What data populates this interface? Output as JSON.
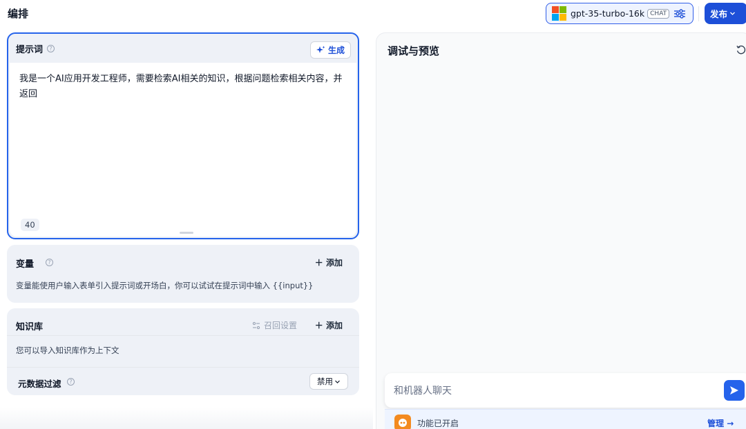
{
  "header": {
    "title": "编排",
    "model": {
      "name": "gpt-35-turbo-16k",
      "mode": "CHAT",
      "logo_colors": [
        "#f25022",
        "#7fba00",
        "#00a4ef",
        "#ffb900"
      ]
    },
    "publish_label": "发布"
  },
  "prompt": {
    "title": "提示词",
    "generate_label": "生成",
    "text": "我是一个AI应用开发工程师，需要检索AI相关的知识，根据问题检索相关内容，并返回",
    "char_count": "40"
  },
  "variables": {
    "title": "变量",
    "add_label": "添加",
    "description": "变量能使用户输入表单引入提示词或开场白，你可以试试在提示词中输入 {{input}}"
  },
  "knowledge": {
    "title": "知识库",
    "recall_label": "召回设置",
    "add_label": "添加",
    "description": "您可以导入知识库作为上下文",
    "metadata_filter": {
      "title": "元数据过滤",
      "value": "禁用"
    }
  },
  "debug": {
    "title": "调试与预览",
    "chat_placeholder": "和机器人聊天",
    "feature_label": "功能已开启",
    "manage_label": "管理"
  },
  "colors": {
    "accent": "#2563eb",
    "primary_button": "#1d4fd8",
    "feature_icon": "#f38a1f"
  }
}
